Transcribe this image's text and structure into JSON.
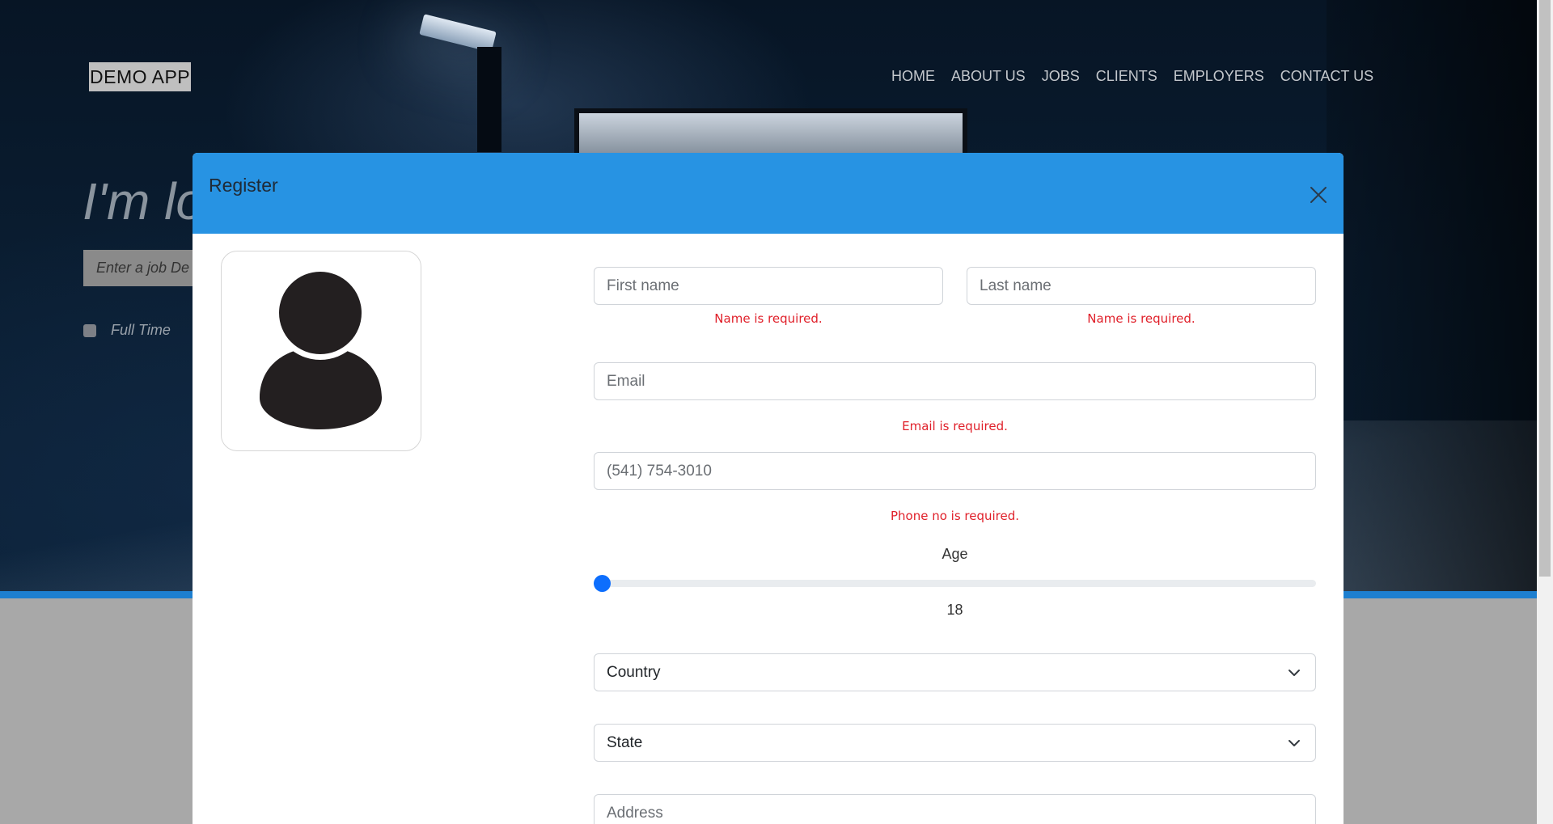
{
  "background": {
    "brand": "DEMO APP",
    "nav": [
      "HOME",
      "ABOUT US",
      "JOBS",
      "CLIENTS",
      "EMPLOYERS",
      "CONTACT US"
    ],
    "hero_heading": "I'm lo",
    "search_placeholder": "Enter a job De",
    "fulltime_label": "Full Time"
  },
  "modal": {
    "title": "Register",
    "close_icon": "close-icon",
    "avatar_icon": "user-silhouette-icon",
    "first_name": {
      "placeholder": "First name",
      "value": "",
      "error": "Name is required."
    },
    "last_name": {
      "placeholder": "Last name",
      "value": "",
      "error": "Name is required."
    },
    "email": {
      "placeholder": "Email",
      "value": "",
      "error": "Email is required."
    },
    "phone": {
      "placeholder": "(541) 754-3010",
      "value": "",
      "error": "Phone no is required."
    },
    "age": {
      "label": "Age",
      "value": "18",
      "fraction": 0.0
    },
    "country": {
      "selected": "Country"
    },
    "state": {
      "selected": "State"
    },
    "address": {
      "placeholder": "Address",
      "value": ""
    }
  },
  "colors": {
    "header": "#2793e3",
    "error": "#e0202a",
    "slider": "#0d6efd"
  }
}
